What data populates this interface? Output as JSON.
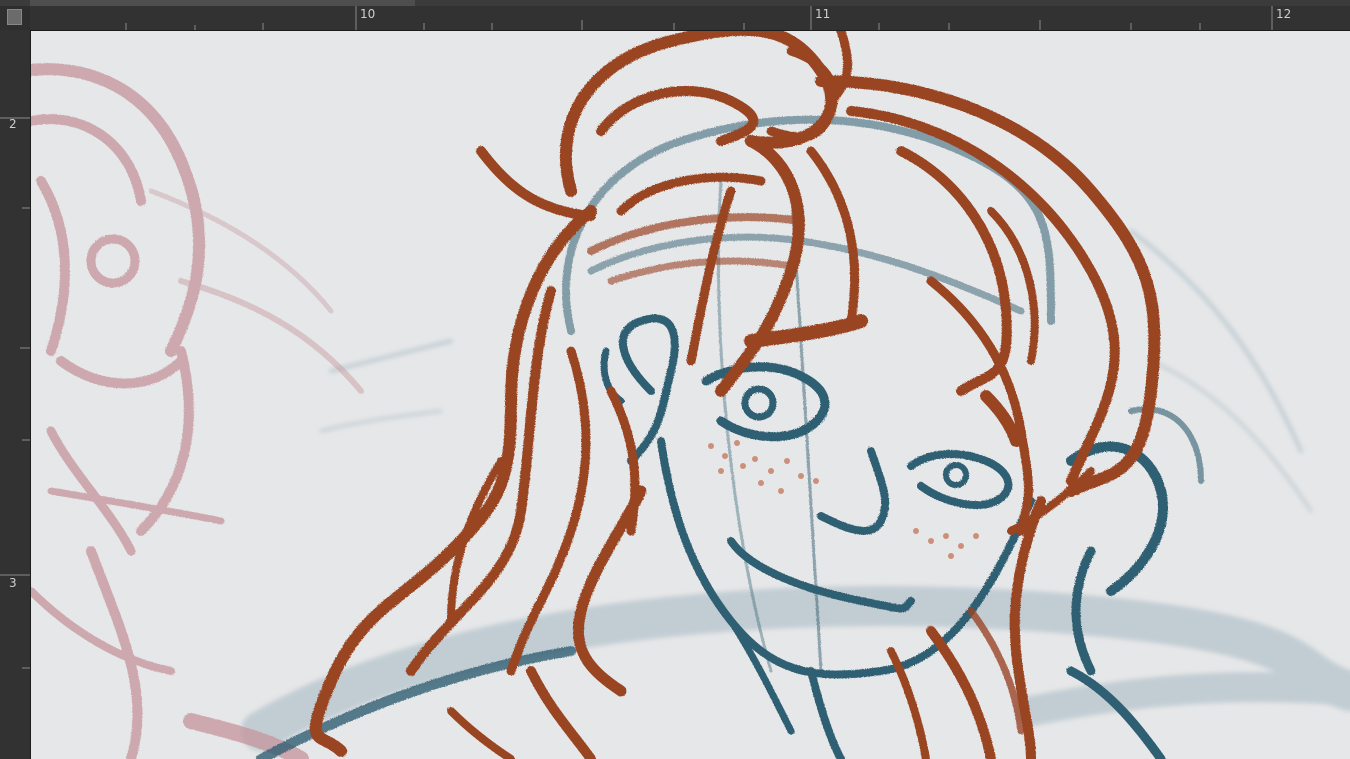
{
  "rulers": {
    "horizontal_labels": [
      "10",
      "11",
      "12"
    ],
    "vertical_labels": [
      "2",
      "3"
    ]
  },
  "canvas": {
    "background": "#e6e7e8",
    "stroke_colors": {
      "hair": "#9a4424",
      "blue_lines": "#2f5e72",
      "pink_sketch": "#c4959c",
      "pale_blue": "#a9bcc6"
    }
  }
}
